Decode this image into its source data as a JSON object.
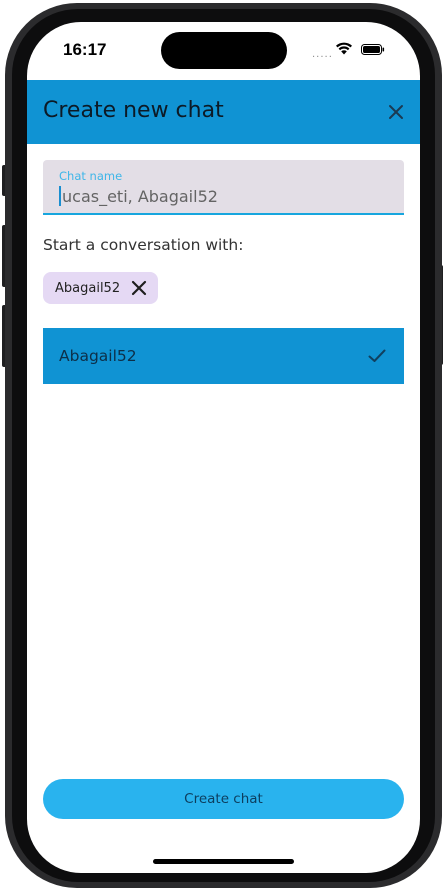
{
  "status_bar": {
    "time": "16:17",
    "signal": "....."
  },
  "header": {
    "title": "Create new chat"
  },
  "chat_name_field": {
    "label": "Chat name",
    "value": "ucas_eti, Abagail52"
  },
  "section_label": "Start a conversation with:",
  "selected_chips": [
    {
      "label": "Abagail52"
    }
  ],
  "results": [
    {
      "label": "Abagail52",
      "selected": true
    }
  ],
  "footer": {
    "create_label": "Create chat"
  },
  "colors": {
    "primary": "#1093d3",
    "accent": "#29b3ee",
    "chip": "#e5d9f4",
    "field": "#e3dee6"
  },
  "icons": {
    "close": "close-icon",
    "chip_remove": "close-icon",
    "check": "check-icon",
    "wifi": "wifi-icon",
    "battery": "battery-icon"
  }
}
